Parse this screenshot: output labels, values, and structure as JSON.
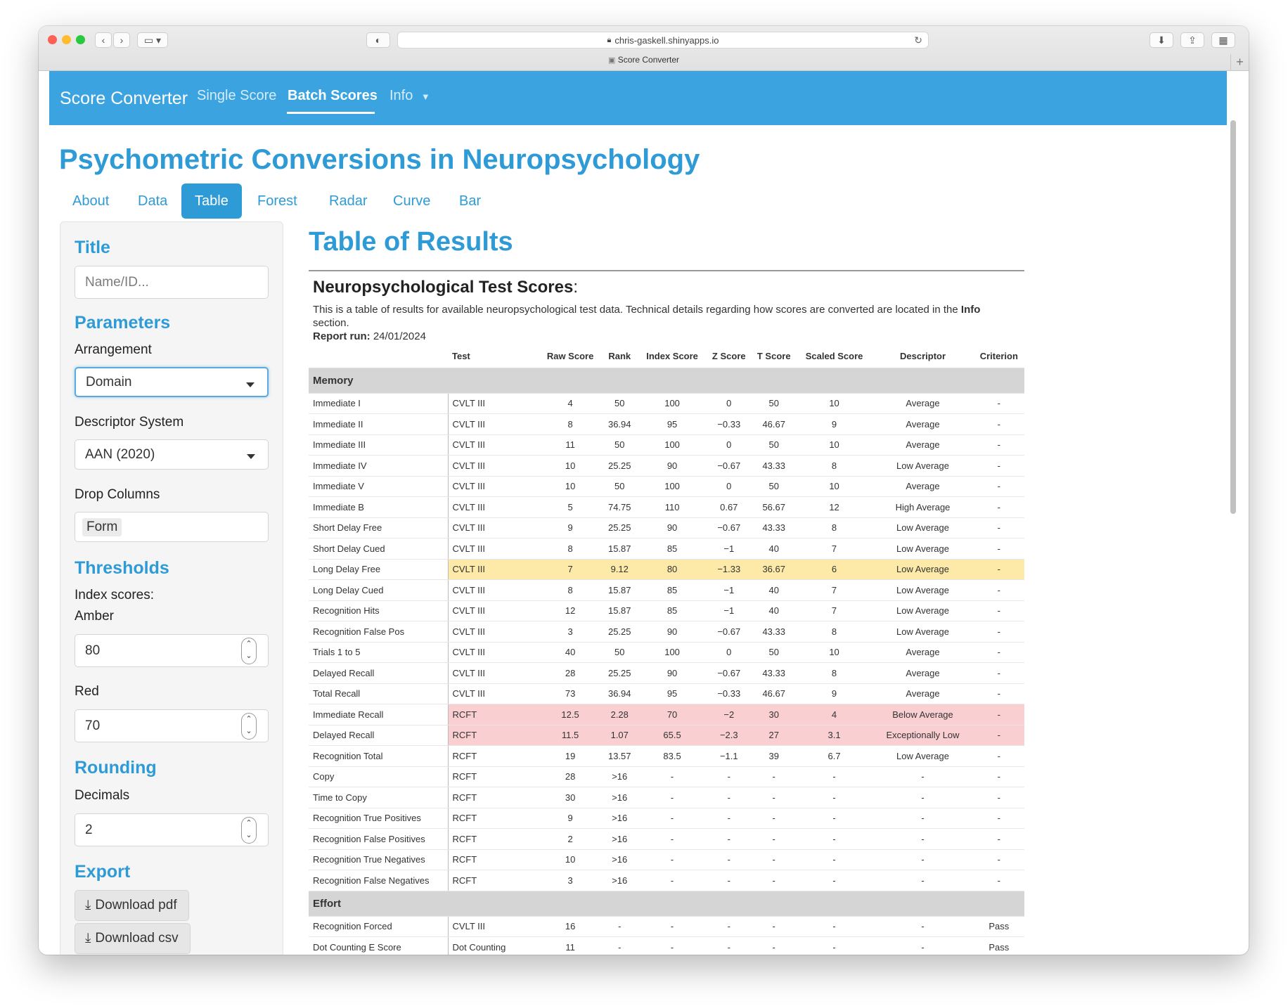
{
  "browser": {
    "url": "chris-gaskell.shinyapps.io",
    "tab_title": "Score Converter"
  },
  "navbar": {
    "brand": "Score Converter",
    "items": [
      {
        "label": "Single Score"
      },
      {
        "label": "Batch Scores"
      },
      {
        "label": "Info"
      }
    ]
  },
  "page": {
    "title": "Psychometric Conversions in Neuropsychology",
    "tabs": [
      "About",
      "Data",
      "Table",
      "Forest",
      "Radar",
      "Curve",
      "Bar"
    ],
    "active_tab": "Table"
  },
  "sidebar": {
    "title_heading": "Title",
    "title_placeholder": "Name/ID...",
    "parameters_heading": "Parameters",
    "arrangement_label": "Arrangement",
    "arrangement_value": "Domain",
    "descriptor_label": "Descriptor System",
    "descriptor_value": "AAN (2020)",
    "drop_columns_label": "Drop Columns",
    "drop_columns_value": "Form",
    "thresholds_heading": "Thresholds",
    "index_scores_label": "Index scores:",
    "amber_label": "Amber",
    "amber_value": "80",
    "red_label": "Red",
    "red_value": "70",
    "rounding_heading": "Rounding",
    "decimals_label": "Decimals",
    "decimals_value": "2",
    "export_heading": "Export",
    "download_pdf": "Download pdf",
    "download_csv": "Download csv"
  },
  "main": {
    "heading": "Table of Results",
    "table_title": "Neuropsychological Test Scores",
    "table_title_suffix": ":",
    "desc_1": "This is a table of results for available neuropsychological test data. Technical details regarding how scores are converted are located in the ",
    "desc_bold": "Info",
    "desc_2": " section.",
    "report_run_label": "Report run:",
    "report_run_value": "24/01/2024"
  },
  "table": {
    "columns": [
      "",
      "Test",
      "Raw Score",
      "Rank",
      "Index Score",
      "Z Score",
      "T Score",
      "Scaled Score",
      "Descriptor",
      "Criterion"
    ],
    "groups": [
      {
        "name": "Memory",
        "rows": [
          {
            "measure": "Immediate I",
            "test": "CVLT III",
            "raw": "4",
            "rank": "50",
            "index": "100",
            "z": "0",
            "t": "50",
            "scaled": "10",
            "descriptor": "Average",
            "criterion": "-",
            "flag": ""
          },
          {
            "measure": "Immediate II",
            "test": "CVLT III",
            "raw": "8",
            "rank": "36.94",
            "index": "95",
            "z": "−0.33",
            "t": "46.67",
            "scaled": "9",
            "descriptor": "Average",
            "criterion": "-",
            "flag": ""
          },
          {
            "measure": "Immediate III",
            "test": "CVLT III",
            "raw": "11",
            "rank": "50",
            "index": "100",
            "z": "0",
            "t": "50",
            "scaled": "10",
            "descriptor": "Average",
            "criterion": "-",
            "flag": ""
          },
          {
            "measure": "Immediate IV",
            "test": "CVLT III",
            "raw": "10",
            "rank": "25.25",
            "index": "90",
            "z": "−0.67",
            "t": "43.33",
            "scaled": "8",
            "descriptor": "Low Average",
            "criterion": "-",
            "flag": ""
          },
          {
            "measure": "Immediate V",
            "test": "CVLT III",
            "raw": "10",
            "rank": "50",
            "index": "100",
            "z": "0",
            "t": "50",
            "scaled": "10",
            "descriptor": "Average",
            "criterion": "-",
            "flag": ""
          },
          {
            "measure": "Immediate B",
            "test": "CVLT III",
            "raw": "5",
            "rank": "74.75",
            "index": "110",
            "z": "0.67",
            "t": "56.67",
            "scaled": "12",
            "descriptor": "High Average",
            "criterion": "-",
            "flag": ""
          },
          {
            "measure": "Short Delay Free",
            "test": "CVLT III",
            "raw": "9",
            "rank": "25.25",
            "index": "90",
            "z": "−0.67",
            "t": "43.33",
            "scaled": "8",
            "descriptor": "Low Average",
            "criterion": "-",
            "flag": ""
          },
          {
            "measure": "Short Delay Cued",
            "test": "CVLT III",
            "raw": "8",
            "rank": "15.87",
            "index": "85",
            "z": "−1",
            "t": "40",
            "scaled": "7",
            "descriptor": "Low Average",
            "criterion": "-",
            "flag": ""
          },
          {
            "measure": "Long Delay Free",
            "test": "CVLT III",
            "raw": "7",
            "rank": "9.12",
            "index": "80",
            "z": "−1.33",
            "t": "36.67",
            "scaled": "6",
            "descriptor": "Low Average",
            "criterion": "-",
            "flag": "amber"
          },
          {
            "measure": "Long Delay Cued",
            "test": "CVLT III",
            "raw": "8",
            "rank": "15.87",
            "index": "85",
            "z": "−1",
            "t": "40",
            "scaled": "7",
            "descriptor": "Low Average",
            "criterion": "-",
            "flag": ""
          },
          {
            "measure": "Recognition Hits",
            "test": "CVLT III",
            "raw": "12",
            "rank": "15.87",
            "index": "85",
            "z": "−1",
            "t": "40",
            "scaled": "7",
            "descriptor": "Low Average",
            "criterion": "-",
            "flag": ""
          },
          {
            "measure": "Recognition False Pos",
            "test": "CVLT III",
            "raw": "3",
            "rank": "25.25",
            "index": "90",
            "z": "−0.67",
            "t": "43.33",
            "scaled": "8",
            "descriptor": "Low Average",
            "criterion": "-",
            "flag": ""
          },
          {
            "measure": "Trials 1 to 5",
            "test": "CVLT III",
            "raw": "40",
            "rank": "50",
            "index": "100",
            "z": "0",
            "t": "50",
            "scaled": "10",
            "descriptor": "Average",
            "criterion": "-",
            "flag": ""
          },
          {
            "measure": "Delayed Recall",
            "test": "CVLT III",
            "raw": "28",
            "rank": "25.25",
            "index": "90",
            "z": "−0.67",
            "t": "43.33",
            "scaled": "8",
            "descriptor": "Average",
            "criterion": "-",
            "flag": ""
          },
          {
            "measure": "Total Recall",
            "test": "CVLT III",
            "raw": "73",
            "rank": "36.94",
            "index": "95",
            "z": "−0.33",
            "t": "46.67",
            "scaled": "9",
            "descriptor": "Average",
            "criterion": "-",
            "flag": ""
          },
          {
            "measure": "Immediate Recall",
            "test": "RCFT",
            "raw": "12.5",
            "rank": "2.28",
            "index": "70",
            "z": "−2",
            "t": "30",
            "scaled": "4",
            "descriptor": "Below Average",
            "criterion": "-",
            "flag": "red"
          },
          {
            "measure": "Delayed Recall",
            "test": "RCFT",
            "raw": "11.5",
            "rank": "1.07",
            "index": "65.5",
            "z": "−2.3",
            "t": "27",
            "scaled": "3.1",
            "descriptor": "Exceptionally Low",
            "criterion": "-",
            "flag": "red"
          },
          {
            "measure": "Recognition Total",
            "test": "RCFT",
            "raw": "19",
            "rank": "13.57",
            "index": "83.5",
            "z": "−1.1",
            "t": "39",
            "scaled": "6.7",
            "descriptor": "Low Average",
            "criterion": "-",
            "flag": ""
          },
          {
            "measure": "Copy",
            "test": "RCFT",
            "raw": "28",
            "rank": ">16",
            "index": "-",
            "z": "-",
            "t": "-",
            "scaled": "-",
            "descriptor": "-",
            "criterion": "-",
            "flag": ""
          },
          {
            "measure": "Time to Copy",
            "test": "RCFT",
            "raw": "30",
            "rank": ">16",
            "index": "-",
            "z": "-",
            "t": "-",
            "scaled": "-",
            "descriptor": "-",
            "criterion": "-",
            "flag": ""
          },
          {
            "measure": "Recognition True Positives",
            "test": "RCFT",
            "raw": "9",
            "rank": ">16",
            "index": "-",
            "z": "-",
            "t": "-",
            "scaled": "-",
            "descriptor": "-",
            "criterion": "-",
            "flag": ""
          },
          {
            "measure": "Recognition False Positives",
            "test": "RCFT",
            "raw": "2",
            "rank": ">16",
            "index": "-",
            "z": "-",
            "t": "-",
            "scaled": "-",
            "descriptor": "-",
            "criterion": "-",
            "flag": ""
          },
          {
            "measure": "Recognition True Negatives",
            "test": "RCFT",
            "raw": "10",
            "rank": ">16",
            "index": "-",
            "z": "-",
            "t": "-",
            "scaled": "-",
            "descriptor": "-",
            "criterion": "-",
            "flag": ""
          },
          {
            "measure": "Recognition False Negatives",
            "test": "RCFT",
            "raw": "3",
            "rank": ">16",
            "index": "-",
            "z": "-",
            "t": "-",
            "scaled": "-",
            "descriptor": "-",
            "criterion": "-",
            "flag": ""
          }
        ]
      },
      {
        "name": "Effort",
        "rows": [
          {
            "measure": "Recognition Forced",
            "test": "CVLT III",
            "raw": "16",
            "rank": "-",
            "index": "-",
            "z": "-",
            "t": "-",
            "scaled": "-",
            "descriptor": "-",
            "criterion": "Pass",
            "flag": ""
          },
          {
            "measure": "Dot Counting E Score",
            "test": "Dot Counting",
            "raw": "11",
            "rank": "-",
            "index": "-",
            "z": "-",
            "t": "-",
            "scaled": "-",
            "descriptor": "-",
            "criterion": "Pass",
            "flag": ""
          }
        ]
      }
    ]
  },
  "colors": {
    "accent": "#3ba3e0",
    "heading": "#2f9bd6",
    "amber_row": "#fdeaa8",
    "red_row": "#f9cfd2"
  }
}
